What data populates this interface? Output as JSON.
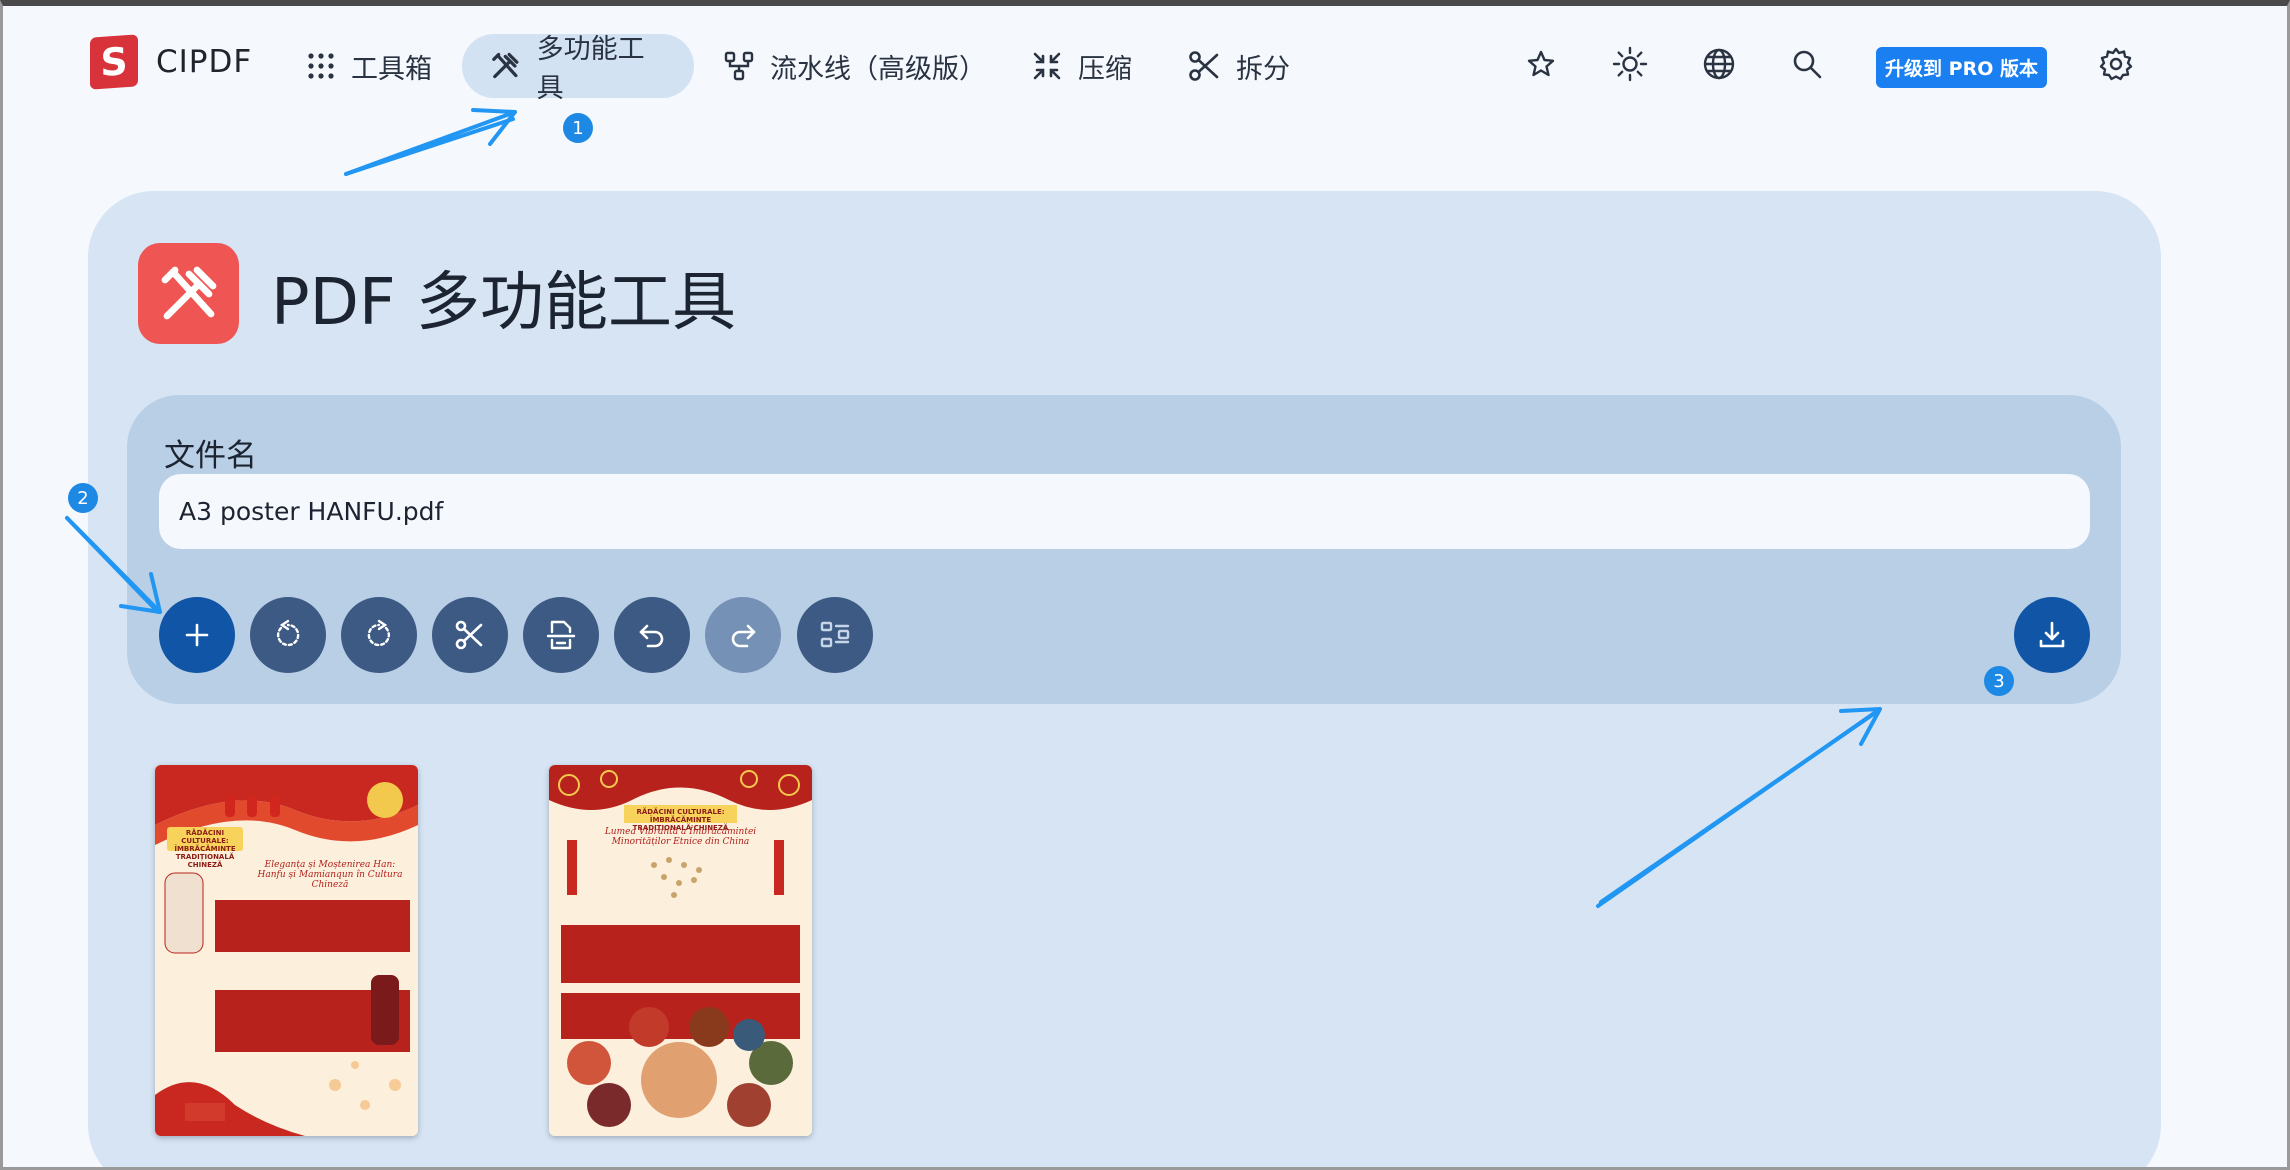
{
  "brand": {
    "logo_letter": "S",
    "name": "CIPDF"
  },
  "nav": {
    "items": [
      {
        "label": "工具箱",
        "icon": "grid-icon"
      },
      {
        "label": "多功能工具",
        "icon": "tools-icon",
        "active": true
      },
      {
        "label": "流水线（高级版）",
        "icon": "pipeline-icon"
      },
      {
        "label": "压缩",
        "icon": "compress-icon"
      },
      {
        "label": "拆分",
        "icon": "scissors-icon"
      }
    ],
    "right_icons": [
      "star-icon",
      "sun-icon",
      "globe-icon",
      "search-icon",
      "gear-icon"
    ],
    "pro_button": "升级到 PRO 版本"
  },
  "page": {
    "title": "PDF 多功能工具",
    "icon": "tools-icon"
  },
  "file": {
    "label": "文件名",
    "value": "A3 poster HANFU.pdf"
  },
  "toolbar": {
    "buttons": [
      "add-icon",
      "rotate-left-icon",
      "rotate-right-icon",
      "cut-icon",
      "split-page-icon",
      "undo-icon",
      "redo-icon",
      "layout-icon"
    ],
    "download": "download-icon"
  },
  "thumbnails": [
    {
      "band": "RĂDĂCINI CULTURALE: ÎMBRĂCĂMINTE TRADIȚIONALĂ CHINEZĂ",
      "heading": "Eleganța și Moștenirea Han: Hanfu și Mamianqun în Cultura Chineză"
    },
    {
      "band": "RĂDĂCINI CULTURALE: ÎMBRĂCĂMINTE TRADIȚIONALĂ CHINEZĂ",
      "heading": "Lumea Vibrantă a Îmbrăcămintei Minorităților Etnice din China"
    }
  ],
  "callouts": [
    "1",
    "2",
    "3"
  ],
  "colors": {
    "accent": "#1a7ff0",
    "primary_button": "#1155a6",
    "tool_button": "#3d5a84",
    "card_bg": "#d6e4f4",
    "panel_bg": "#b9cfe6",
    "tool_icon_bg": "#ee5553",
    "brand_red": "#d8323a",
    "annotation": "#2196f3"
  }
}
